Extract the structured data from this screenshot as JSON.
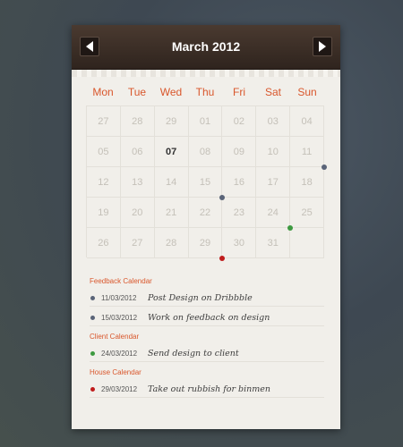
{
  "header": {
    "title": "March 2012"
  },
  "weekdays": [
    "Mon",
    "Tue",
    "Wed",
    "Thu",
    "Fri",
    "Sat",
    "Sun"
  ],
  "weeks": [
    [
      "27",
      "28",
      "29",
      "01",
      "02",
      "03",
      "04"
    ],
    [
      "05",
      "06",
      "07",
      "08",
      "09",
      "10",
      "11"
    ],
    [
      "12",
      "13",
      "14",
      "15",
      "16",
      "17",
      "18"
    ],
    [
      "19",
      "20",
      "21",
      "22",
      "23",
      "24",
      "25"
    ],
    [
      "26",
      "27",
      "28",
      "29",
      "30",
      "31",
      ""
    ]
  ],
  "today": "07",
  "colors": {
    "feedback": "#5a6478",
    "client": "#3d9a40",
    "house": "#c01c1c",
    "accent": "#d9572c"
  },
  "calendars": [
    {
      "name": "Feedback Calendar",
      "events": [
        {
          "date": "11/03/2012",
          "title": "Post Design on Dribbble",
          "color": "#5a6478"
        },
        {
          "date": "15/03/2012",
          "title": "Work on feedback on design",
          "color": "#5a6478"
        }
      ]
    },
    {
      "name": "Client Calendar",
      "events": [
        {
          "date": "24/03/2012",
          "title": "Send design to client",
          "color": "#3d9a40"
        }
      ]
    },
    {
      "name": "House Calendar",
      "events": [
        {
          "date": "29/03/2012",
          "title": "Take out rubbish for binmen",
          "color": "#c01c1c"
        }
      ]
    }
  ]
}
